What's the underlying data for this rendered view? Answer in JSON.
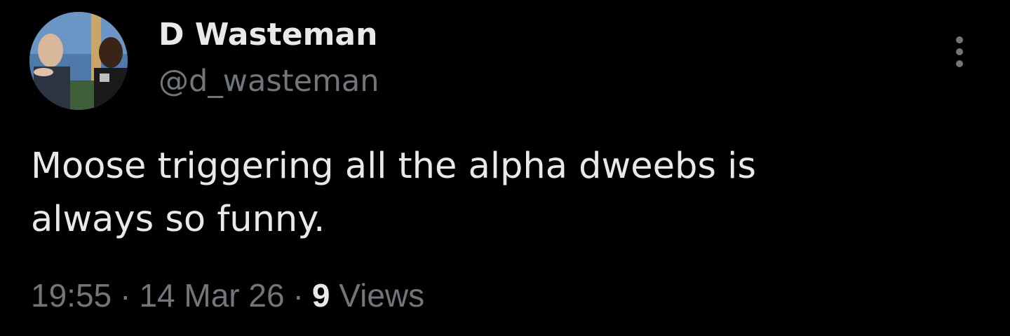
{
  "tweet": {
    "author": {
      "display_name": "D Wasteman",
      "handle": "@d_wasteman",
      "avatar_icon": "profile-photo"
    },
    "more_icon": "more-options-icon",
    "text": "Moose triggering all the alpha dweebs is\nalways so funny.",
    "meta": {
      "time": "19:55",
      "separator": "·",
      "date": "14 Mar 26",
      "views_count": "9",
      "views_label": "Views"
    }
  },
  "colors": {
    "background": "#000000",
    "primary_text": "#e7e9ea",
    "secondary_text": "#71767b"
  }
}
